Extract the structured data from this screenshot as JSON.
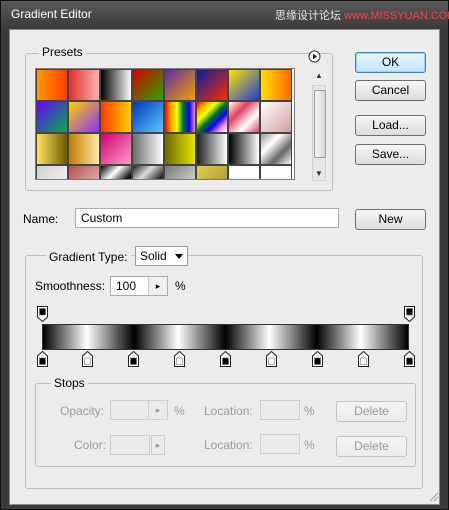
{
  "window": {
    "title": "Gradient Editor",
    "watermark_a": "思缘设计论坛",
    "watermark_b": "www.MISSYUAN.COM"
  },
  "presets": {
    "legend": "Presets",
    "menu_icon": "circle-triangle-right-icon",
    "swatches": [
      "linear-gradient(90deg,#ff9a00,#ff3d00)",
      "linear-gradient(90deg,#e03030,#ffb0b0)",
      "linear-gradient(90deg,#000,#fff)",
      "linear-gradient(135deg,#d40000,#2aa600)",
      "linear-gradient(135deg,#5b2ba8,#f5a000)",
      "linear-gradient(135deg,#001fa0,#ff2a00)",
      "linear-gradient(135deg,#ffe600,#1b3bd6)",
      "linear-gradient(90deg,#ffe000,#ff6a00)",
      "linear-gradient(135deg,#6a00ff,#00b04a)",
      "linear-gradient(135deg,#ffd400,#8b2cff)",
      "linear-gradient(90deg,#ff3a00,#ffd000)",
      "linear-gradient(135deg,#0038b8,#5cc7ff)",
      "linear-gradient(90deg,red,orange,yellow,green,blue,violet)",
      "linear-gradient(135deg,red,orange,yellow,green,blue,violet,#fff)",
      "linear-gradient(135deg,#ffffff,#e04060,#ffffff,#e04060)",
      "linear-gradient(135deg,#ffffff,#d0a0a0)",
      "linear-gradient(90deg,#ffe65a,#6e5a00)",
      "linear-gradient(90deg,#c27d00,#ffe9a0)",
      "linear-gradient(135deg,#d0006e,#ff9ccc)",
      "linear-gradient(90deg,#6c6c6c,#ffffff)",
      "linear-gradient(90deg,#6a6a00,#e6e600)",
      "linear-gradient(90deg,#202020,#ffffff)",
      "linear-gradient(90deg,#000000,#ffffff)",
      "linear-gradient(135deg,#999,#fff,#666,#fff)",
      "linear-gradient(135deg,#cfcfcf,#ffffff)",
      "linear-gradient(135deg,#b05050,#f0d0c0)",
      "linear-gradient(135deg,#000,#fff,#000,#fff)",
      "linear-gradient(135deg,#222,#ddd,#222,#ddd)",
      "linear-gradient(135deg,#777,#eee)",
      "linear-gradient(135deg,#e0cc55,#a09030)",
      "linear-gradient(90deg,#ffffff,#ffffff)",
      "linear-gradient(90deg,#ffffff,#ffffff)"
    ],
    "scroll_up_glyph": "▲",
    "scroll_down_glyph": "▼"
  },
  "buttons": {
    "ok": "OK",
    "cancel": "Cancel",
    "load": "Load...",
    "save": "Save...",
    "new": "New"
  },
  "name": {
    "label": "Name:",
    "value": "Custom"
  },
  "gradient": {
    "type_label": "Gradient Type:",
    "type_value": "Solid",
    "smoothness_label": "Smoothness:",
    "smoothness_value": "100",
    "smoothness_unit": "%"
  },
  "stops": {
    "legend": "Stops",
    "opacity_label": "Opacity:",
    "opacity_unit": "%",
    "location_label": "Location:",
    "location_unit": "%",
    "color_label": "Color:",
    "delete_label": "Delete",
    "color_stops_pct": [
      0,
      12.5,
      25,
      37.5,
      50,
      62.5,
      75,
      87.5,
      100
    ],
    "color_stop_colors": [
      "#000000",
      "#ffffff",
      "#000000",
      "#ffffff",
      "#000000",
      "#ffffff",
      "#000000",
      "#ffffff",
      "#000000"
    ],
    "opacity_stops_pct": [
      0,
      100
    ]
  }
}
